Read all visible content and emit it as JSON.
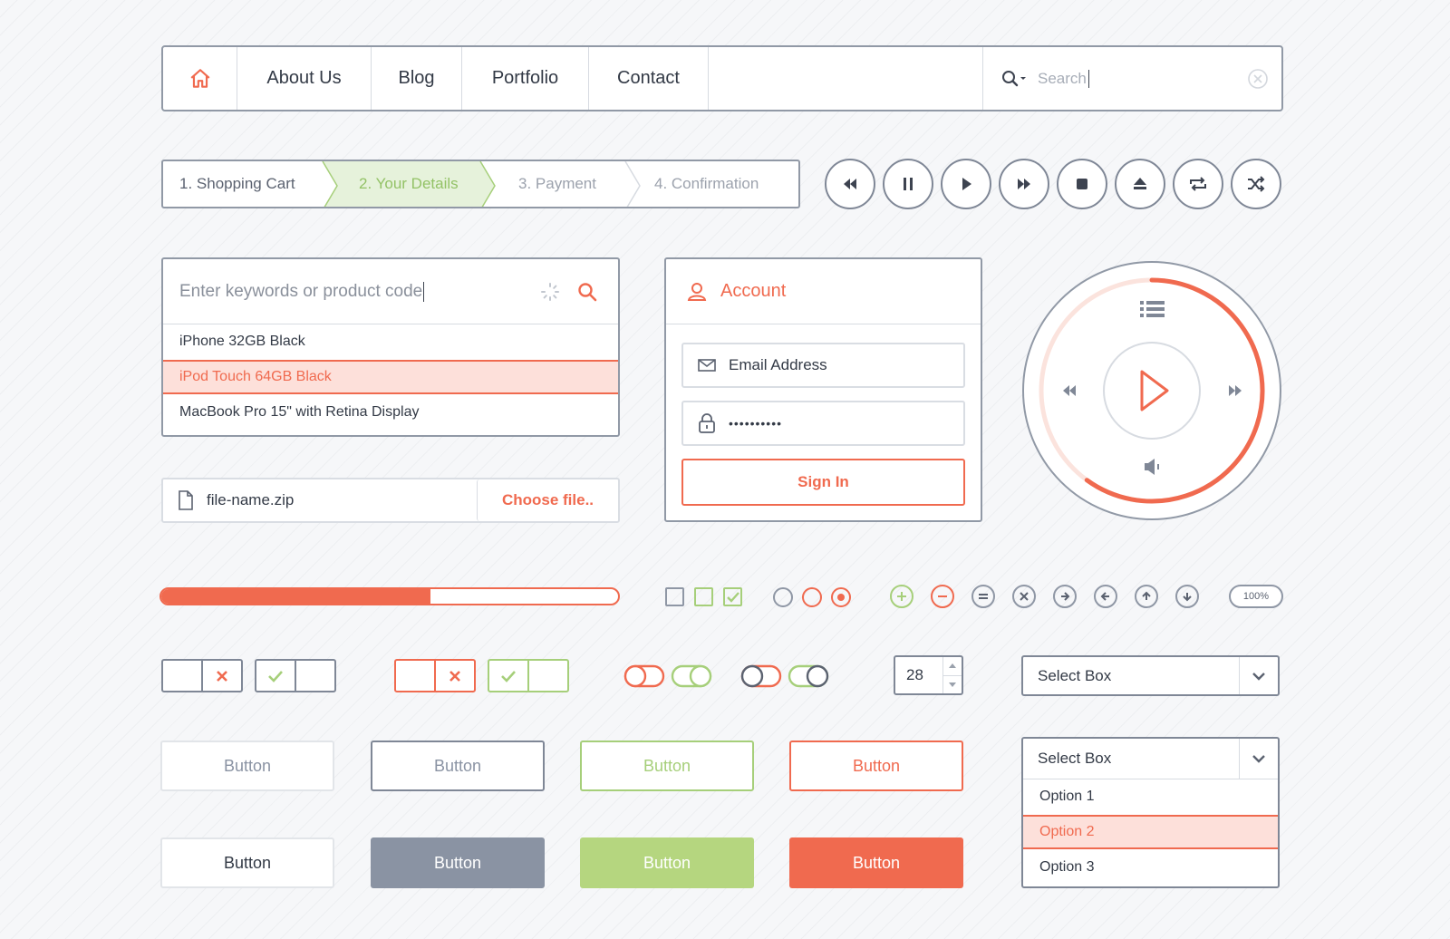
{
  "nav": {
    "items": [
      "About Us",
      "Blog",
      "Portfolio",
      "Contact"
    ],
    "search_placeholder": "Search"
  },
  "steps": [
    "1. Shopping Cart",
    "2. Your Details",
    "3. Payment",
    "4. Confirmation"
  ],
  "active_step": 2,
  "product_search": {
    "placeholder": "Enter keywords or product code",
    "results": [
      "iPhone 32GB Black",
      "iPod Touch 64GB Black",
      "MacBook Pro 15\" with Retina Display"
    ],
    "selected_index": 1
  },
  "file_upload": {
    "file_name": "file-name.zip",
    "button_label": "Choose file.."
  },
  "account": {
    "title": "Account",
    "email_placeholder": "Email Address",
    "password_value": "••••••••••",
    "sign_in_label": "Sign In"
  },
  "progress": {
    "value": 0.59
  },
  "zoom_badge": "100%",
  "stepper_value": "28",
  "select_boxes": {
    "closed_label": "Select Box",
    "open_label": "Select Box",
    "options": [
      "Option 1",
      "Option 2",
      "Option 3"
    ],
    "selected_index": 1
  },
  "buttons": {
    "label": "Button",
    "rows": [
      [
        "Button",
        "Button",
        "Button",
        "Button"
      ],
      [
        "Button",
        "Button",
        "Button",
        "Button"
      ]
    ]
  },
  "colors": {
    "accent": "#f06a4f",
    "green": "#a6cf7a",
    "slate": "#8a93a3",
    "border": "#9199a6",
    "highlight_bg": "#fde0da"
  },
  "icons": [
    "home-icon",
    "search-icon",
    "clear-icon",
    "rewind-icon",
    "pause-icon",
    "play-icon",
    "fast-forward-icon",
    "stop-icon",
    "eject-icon",
    "repeat-icon",
    "shuffle-icon",
    "spinner-icon",
    "user-icon",
    "mail-icon",
    "lock-icon",
    "file-icon",
    "list-icon",
    "volume-icon"
  ]
}
